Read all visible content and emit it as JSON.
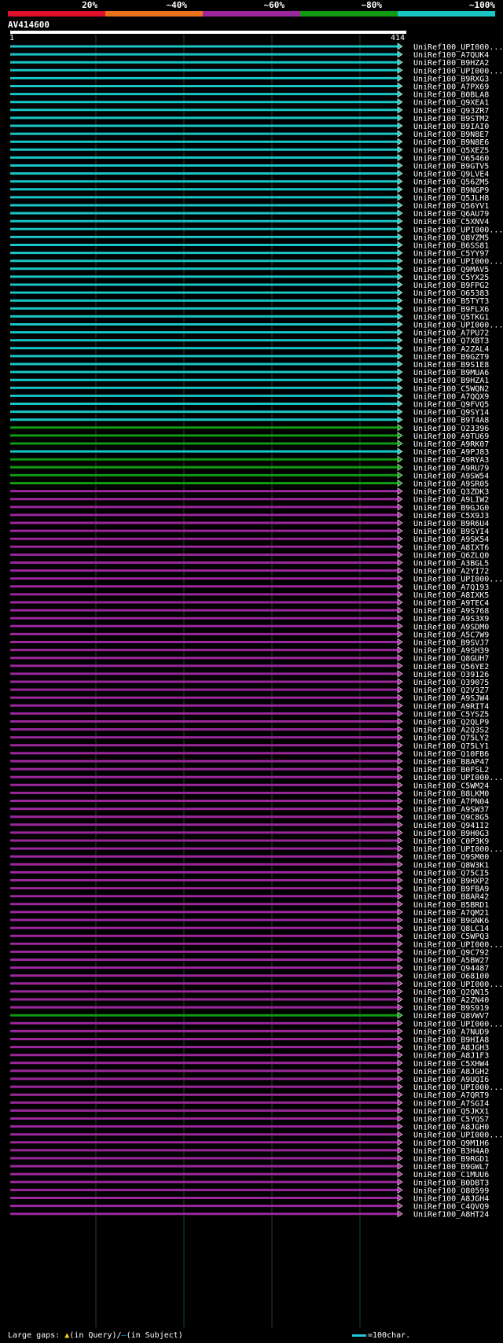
{
  "legend": {
    "labels": [
      "20%",
      "~40%",
      "~60%",
      "~80%",
      "~100%"
    ],
    "colors": [
      "#e0102a",
      "#e8731a",
      "#9c279c",
      "#119911",
      "#19c6c6"
    ]
  },
  "query": {
    "name": "AV414600",
    "start": "1",
    "end": "414",
    "length": 414
  },
  "footer": {
    "large_gaps_label": "Large gaps:",
    "in_query": "(in Query)/",
    "dash": "–",
    "in_subject": "(in Subject)",
    "scale_text": "=100char."
  },
  "hits": [
    {
      "name": "UniRef100_UPI000...",
      "tier": 4
    },
    {
      "name": "UniRef100_A7QUK4",
      "tier": 4
    },
    {
      "name": "UniRef100_B9HZA2",
      "tier": 4
    },
    {
      "name": "UniRef100_UPI000...",
      "tier": 4
    },
    {
      "name": "UniRef100_B9RXG3",
      "tier": 4
    },
    {
      "name": "UniRef100_A7PX69",
      "tier": 4
    },
    {
      "name": "UniRef100_B0BLA8",
      "tier": 4
    },
    {
      "name": "UniRef100_Q9XEA1",
      "tier": 4
    },
    {
      "name": "UniRef100_Q93ZR7",
      "tier": 4
    },
    {
      "name": "UniRef100_B9STM2",
      "tier": 4
    },
    {
      "name": "UniRef100_B9IAI0",
      "tier": 4
    },
    {
      "name": "UniRef100_B9N8E7",
      "tier": 4
    },
    {
      "name": "UniRef100_B9N8E6",
      "tier": 4
    },
    {
      "name": "UniRef100_Q5XEZ5",
      "tier": 4
    },
    {
      "name": "UniRef100_O65460",
      "tier": 4
    },
    {
      "name": "UniRef100_B9GTV5",
      "tier": 4
    },
    {
      "name": "UniRef100_Q9LVE4",
      "tier": 4
    },
    {
      "name": "UniRef100_Q56ZM5",
      "tier": 4
    },
    {
      "name": "UniRef100_B9NGP9",
      "tier": 4
    },
    {
      "name": "UniRef100_Q5JLH8",
      "tier": 4
    },
    {
      "name": "UniRef100_Q56YV1",
      "tier": 4
    },
    {
      "name": "UniRef100_Q6AU79",
      "tier": 4
    },
    {
      "name": "UniRef100_C5XNV4",
      "tier": 4
    },
    {
      "name": "UniRef100_UPI000...",
      "tier": 4
    },
    {
      "name": "UniRef100_Q8VZM5",
      "tier": 4
    },
    {
      "name": "UniRef100_B6SS81",
      "tier": 4
    },
    {
      "name": "UniRef100_C5YY97",
      "tier": 4
    },
    {
      "name": "UniRef100_UPI000...",
      "tier": 4
    },
    {
      "name": "UniRef100_Q9MAV5",
      "tier": 4
    },
    {
      "name": "UniRef100_C5YX25",
      "tier": 4
    },
    {
      "name": "UniRef100_B9FPG2",
      "tier": 4
    },
    {
      "name": "UniRef100_O65383",
      "tier": 4
    },
    {
      "name": "UniRef100_B5TYT3",
      "tier": 4
    },
    {
      "name": "UniRef100_B9FLX6",
      "tier": 4
    },
    {
      "name": "UniRef100_Q5TKG1",
      "tier": 4
    },
    {
      "name": "UniRef100_UPI000...",
      "tier": 4
    },
    {
      "name": "UniRef100_A7PU72",
      "tier": 4
    },
    {
      "name": "UniRef100_Q7XBT3",
      "tier": 4
    },
    {
      "name": "UniRef100_A2ZAL4",
      "tier": 4
    },
    {
      "name": "UniRef100_B9GZT9",
      "tier": 4
    },
    {
      "name": "UniRef100_B9S1E8",
      "tier": 4
    },
    {
      "name": "UniRef100_B9MUA6",
      "tier": 4
    },
    {
      "name": "UniRef100_B9HZA1",
      "tier": 4
    },
    {
      "name": "UniRef100_C5WQN2",
      "tier": 4
    },
    {
      "name": "UniRef100_A7QQX9",
      "tier": 4
    },
    {
      "name": "UniRef100_Q9FVQ5",
      "tier": 4
    },
    {
      "name": "UniRef100_Q9SY14",
      "tier": 4
    },
    {
      "name": "UniRef100_B9T4A8",
      "tier": 4
    },
    {
      "name": "UniRef100_O23396",
      "tier": 3
    },
    {
      "name": "UniRef100_A9TU69",
      "tier": 3
    },
    {
      "name": "UniRef100_A9RK07",
      "tier": 3
    },
    {
      "name": "UniRef100_A9PJ83",
      "tier": 4
    },
    {
      "name": "UniRef100_A9RYA3",
      "tier": 3
    },
    {
      "name": "UniRef100_A9RU79",
      "tier": 3
    },
    {
      "name": "UniRef100_A9SW54",
      "tier": 3
    },
    {
      "name": "UniRef100_A9SR05",
      "tier": 3
    },
    {
      "name": "UniRef100_Q3ZDK3",
      "tier": 2
    },
    {
      "name": "UniRef100_A9LIW2",
      "tier": 2
    },
    {
      "name": "UniRef100_B9GJG0",
      "tier": 2
    },
    {
      "name": "UniRef100_C5X9J3",
      "tier": 2
    },
    {
      "name": "UniRef100_B9R6U4",
      "tier": 2
    },
    {
      "name": "UniRef100_B9SYI4",
      "tier": 2
    },
    {
      "name": "UniRef100_A9SK54",
      "tier": 2
    },
    {
      "name": "UniRef100_A8IXT6",
      "tier": 2
    },
    {
      "name": "UniRef100_Q6ZLQ0",
      "tier": 2
    },
    {
      "name": "UniRef100_A3BGL5",
      "tier": 2
    },
    {
      "name": "UniRef100_A2YI72",
      "tier": 2
    },
    {
      "name": "UniRef100_UPI000...",
      "tier": 2
    },
    {
      "name": "UniRef100_A7Q193",
      "tier": 2
    },
    {
      "name": "UniRef100_A8IXK5",
      "tier": 2
    },
    {
      "name": "UniRef100_A9TEC4",
      "tier": 2
    },
    {
      "name": "UniRef100_A9S768",
      "tier": 2
    },
    {
      "name": "UniRef100_A9S3X9",
      "tier": 2
    },
    {
      "name": "UniRef100_A9SDM0",
      "tier": 2
    },
    {
      "name": "UniRef100_A5C7W9",
      "tier": 2
    },
    {
      "name": "UniRef100_B9SVJ7",
      "tier": 2
    },
    {
      "name": "UniRef100_A9SH39",
      "tier": 2
    },
    {
      "name": "UniRef100_Q8GUH7",
      "tier": 2
    },
    {
      "name": "UniRef100_Q56YE2",
      "tier": 2
    },
    {
      "name": "UniRef100_O39126",
      "tier": 2
    },
    {
      "name": "UniRef100_O39075",
      "tier": 2
    },
    {
      "name": "UniRef100_Q2V3Z7",
      "tier": 2
    },
    {
      "name": "UniRef100_A9SJW4",
      "tier": 2
    },
    {
      "name": "UniRef100_A9RIT4",
      "tier": 2
    },
    {
      "name": "UniRef100_C5YSZ5",
      "tier": 2
    },
    {
      "name": "UniRef100_Q2QLP9",
      "tier": 2
    },
    {
      "name": "UniRef100_A2Q3S2",
      "tier": 2
    },
    {
      "name": "UniRef100_Q75LY2",
      "tier": 2
    },
    {
      "name": "UniRef100_Q75LY1",
      "tier": 2
    },
    {
      "name": "UniRef100_Q10FB6",
      "tier": 2
    },
    {
      "name": "UniRef100_B8AP47",
      "tier": 2
    },
    {
      "name": "UniRef100_B0FSL2",
      "tier": 2
    },
    {
      "name": "UniRef100_UPI000...",
      "tier": 2
    },
    {
      "name": "UniRef100_C5WM24",
      "tier": 2
    },
    {
      "name": "UniRef100_B8LKM0",
      "tier": 2
    },
    {
      "name": "UniRef100_A7PN04",
      "tier": 2
    },
    {
      "name": "UniRef100_A9SW37",
      "tier": 2
    },
    {
      "name": "UniRef100_Q9C8G5",
      "tier": 2
    },
    {
      "name": "UniRef100_Q941I2",
      "tier": 2
    },
    {
      "name": "UniRef100_B9H0G3",
      "tier": 2
    },
    {
      "name": "UniRef100_C0P3K9",
      "tier": 2
    },
    {
      "name": "UniRef100_UPI000...",
      "tier": 2
    },
    {
      "name": "UniRef100_Q9SM00",
      "tier": 2
    },
    {
      "name": "UniRef100_Q8W3K1",
      "tier": 2
    },
    {
      "name": "UniRef100_Q75CI5",
      "tier": 2
    },
    {
      "name": "UniRef100_B9HXP2",
      "tier": 2
    },
    {
      "name": "UniRef100_B9FBA9",
      "tier": 2
    },
    {
      "name": "UniRef100_B8AR42",
      "tier": 2
    },
    {
      "name": "UniRef100_B5BRD1",
      "tier": 2
    },
    {
      "name": "UniRef100_A7QM21",
      "tier": 2
    },
    {
      "name": "UniRef100_B9GNK6",
      "tier": 2
    },
    {
      "name": "UniRef100_Q8LC14",
      "tier": 2
    },
    {
      "name": "UniRef100_C5WPQ3",
      "tier": 2
    },
    {
      "name": "UniRef100_UPI000...",
      "tier": 2
    },
    {
      "name": "UniRef100_Q9C792",
      "tier": 2
    },
    {
      "name": "UniRef100_A5BW27",
      "tier": 2
    },
    {
      "name": "UniRef100_Q94487",
      "tier": 2
    },
    {
      "name": "UniRef100_O68100",
      "tier": 2
    },
    {
      "name": "UniRef100_UPI000...",
      "tier": 2
    },
    {
      "name": "UniRef100_Q2QN15",
      "tier": 2
    },
    {
      "name": "UniRef100_A2ZN40",
      "tier": 2
    },
    {
      "name": "UniRef100_B9S919",
      "tier": 2
    },
    {
      "name": "UniRef100_Q8VWV7",
      "tier": 3
    },
    {
      "name": "UniRef100_UPI000...",
      "tier": 2
    },
    {
      "name": "UniRef100_A7NUD9",
      "tier": 2
    },
    {
      "name": "UniRef100_B9HIA8",
      "tier": 2
    },
    {
      "name": "UniRef100_A8JGH3",
      "tier": 2
    },
    {
      "name": "UniRef100_A8J1F3",
      "tier": 2
    },
    {
      "name": "UniRef100_C5XHW4",
      "tier": 2
    },
    {
      "name": "UniRef100_A8JGH2",
      "tier": 2
    },
    {
      "name": "UniRef100_A9UQI6",
      "tier": 2
    },
    {
      "name": "UniRef100_UPI000...",
      "tier": 2
    },
    {
      "name": "UniRef100_A7QRT9",
      "tier": 2
    },
    {
      "name": "UniRef100_A7SGI4",
      "tier": 2
    },
    {
      "name": "UniRef100_Q5JKX1",
      "tier": 2
    },
    {
      "name": "UniRef100_C5YQS7",
      "tier": 2
    },
    {
      "name": "UniRef100_A8JGH0",
      "tier": 2
    },
    {
      "name": "UniRef100_UPI000...",
      "tier": 2
    },
    {
      "name": "UniRef100_Q9M1H6",
      "tier": 2
    },
    {
      "name": "UniRef100_B3H4A0",
      "tier": 2
    },
    {
      "name": "UniRef100_B9RGD1",
      "tier": 2
    },
    {
      "name": "UniRef100_B9GWL7",
      "tier": 2
    },
    {
      "name": "UniRef100_C1MUU6",
      "tier": 2
    },
    {
      "name": "UniRef100_B0DBT3",
      "tier": 2
    },
    {
      "name": "UniRef100_O80599",
      "tier": 2
    },
    {
      "name": "UniRef100_A8JGH4",
      "tier": 2
    },
    {
      "name": "UniRef100_C4QVQ9",
      "tier": 2
    },
    {
      "name": "UniRef100_A8HT24",
      "tier": 2
    }
  ]
}
